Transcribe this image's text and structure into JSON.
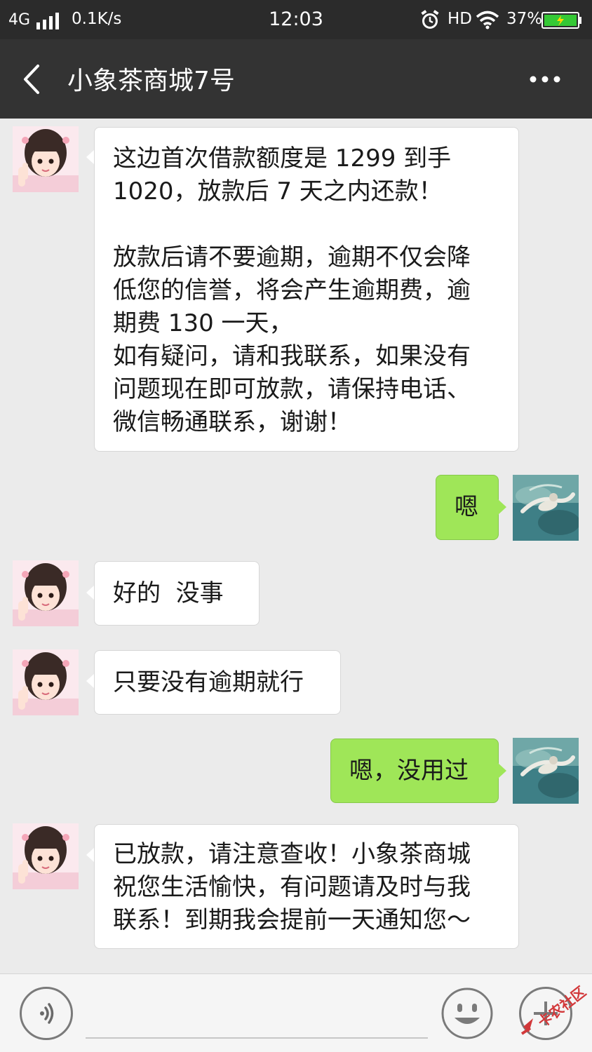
{
  "status_bar": {
    "network": "4G",
    "speed": "0.1K/s",
    "time": "12:03",
    "hd": "HD",
    "battery_percent": "37%"
  },
  "header": {
    "title": "小象茶商城7号",
    "back_icon": "back-chevron-icon",
    "more_icon": "more-dots-icon"
  },
  "messages": [
    {
      "side": "left",
      "lines": [
        "这边首次借款额度是 1299 到手",
        "1020，放款后 7 天之内还款！",
        "",
        "放款后请不要逾期，逾期不仅会降",
        "低您的信誉，将会产生逾期费，逾",
        "期费 130 一天，",
        "如有疑问，请和我联系，如果没有",
        "问题现在即可放款，请保持电话、",
        "微信畅通联系，谢谢！"
      ]
    },
    {
      "side": "right",
      "lines": [
        "嗯"
      ]
    },
    {
      "side": "left",
      "lines": [
        "好的  没事"
      ]
    },
    {
      "side": "left",
      "lines": [
        "只要没有逾期就行"
      ]
    },
    {
      "side": "right",
      "lines": [
        "嗯，没用过"
      ]
    },
    {
      "side": "left",
      "lines": [
        "已放款，请注意查收！小象茶商城",
        "祝您生活愉快，有问题请及时与我",
        "联系！到期我会提前一天通知您～"
      ]
    }
  ],
  "bottom_bar": {
    "voice_icon": "voice-icon",
    "emoji_icon": "emoji-icon",
    "plus_icon": "plus-icon"
  },
  "watermark": "卡农社区",
  "colors": {
    "header_bg": "#333333",
    "status_bg": "#2b2b2b",
    "chat_bg": "#ebebeb",
    "right_bubble": "#9fe658",
    "battery_fill": "#35c835"
  }
}
